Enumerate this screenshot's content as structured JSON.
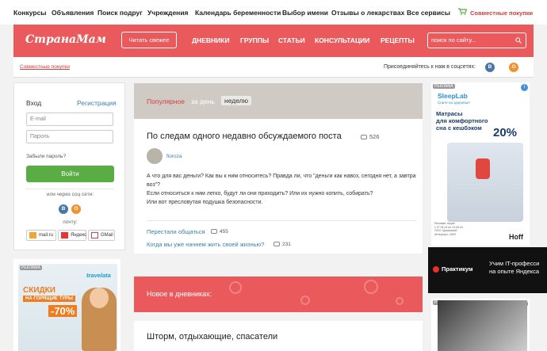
{
  "topnav": {
    "items": [
      "Конкурсы",
      "Объявления",
      "Поиск подруг",
      "Учреждения",
      "Календарь беременности",
      "Выбор имени",
      "Отзывы о лекарствах",
      "Все сервисы"
    ],
    "joint_purchases": "Совместные покупки"
  },
  "header": {
    "logo": "СтранаМам",
    "read_fresh": "Читать свежее",
    "menu": [
      "ДНЕВНИКИ",
      "ГРУППЫ",
      "СТАТЬИ",
      "КОНСУЛЬТАЦИИ",
      "РЕЦЕПТЫ"
    ],
    "search_placeholder": "поиск по сайту..."
  },
  "subbar": {
    "joint_purchases": "Совместные покупки",
    "join_social": "Присоединяйтесь к нам в соцсетях:",
    "vk": "В",
    "ok": "О"
  },
  "login": {
    "title": "Вход",
    "register": "Регистрация",
    "email_placeholder": "E-mail",
    "password_placeholder": "Пароль",
    "forgot": "Забыли пароль?",
    "submit": "Войти",
    "or_social": "или через соц сети:",
    "vk": "В",
    "ok": "О",
    "mail_label": "почту:",
    "mail_services": [
      "mail.ru",
      "Яндекс",
      "GMail"
    ]
  },
  "ad_left": {
    "badge": "РЕКЛАМА",
    "brand": "travelata",
    "line1": "СКИДКИ",
    "line2": "НА ГОРЯЩИЕ ТУРЫ",
    "discount": "-70%"
  },
  "popular": {
    "label": "Популярное",
    "period_day": "за день",
    "period_week": "неделю"
  },
  "post": {
    "title": "По следам одного недавно обсуждаемого поста",
    "comments": "526",
    "author": "fioroza",
    "body": [
      "А что для вас деньги? Как вы к ним относитесь? Правда ли, что \"деньги как навоз, сегодня нет, а завтра воз\"?",
      "Если относиться к ним легко, будут ли они приходить? Или их нужно копить, собирать?",
      "Или вот пресловутая подушка безопасности."
    ],
    "related": [
      {
        "title": "Перестали общаться",
        "count": "455"
      },
      {
        "title": "Когда мы уже начнем жить своей жизнью?",
        "count": "231"
      }
    ]
  },
  "diaries": {
    "title": "Новое в дневниках:"
  },
  "post2": {
    "title": "Шторм, отдыхающие, спасатели"
  },
  "ad_right": {
    "badge": "РЕКЛАМА",
    "brand": "SleepLab",
    "tagline": "Спите на здоровье!",
    "headline": [
      "Матрасы",
      "для комфортного",
      "сна с кешбэком"
    ],
    "percent": "20%",
    "fine_print": [
      "Реклама. Акция",
      "с 27.05.24 по 23.06.24,",
      "ООО «Домашний",
      "Интерьер», ИНН"
    ],
    "brand2": "Hoff"
  },
  "praktikum": {
    "logo": "Практикум",
    "line1": "Учим IT-професси",
    "line2": "на опыте Яндекса"
  },
  "ad_right2": {
    "badge": "РЕКЛАМА"
  },
  "colors": {
    "brand_red": "#ea5a5c",
    "link_blue": "#3a7fb5",
    "green": "#5aac44"
  }
}
